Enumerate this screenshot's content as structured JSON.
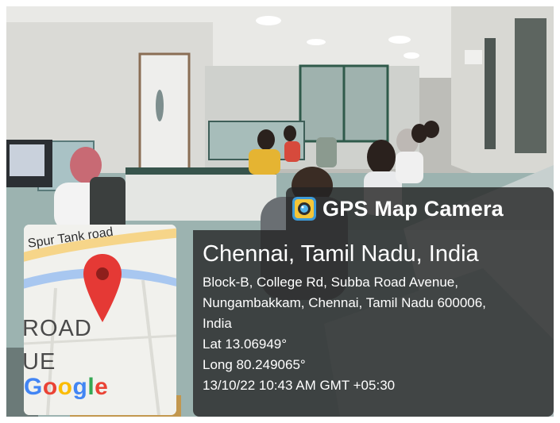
{
  "stamp": {
    "app_title": "GPS Map Camera",
    "city": "Chennai, Tamil Nadu, India",
    "address_lines": [
      "Block-B, College Rd, Subba Road Avenue,",
      "Nungambakkam, Chennai, Tamil Nadu 600006,",
      "India"
    ],
    "latitude": "Lat 13.06949°",
    "longitude": "Long 80.249065°",
    "datetime": "13/10/22 10:43 AM GMT +05:30"
  },
  "map": {
    "road_label": "Spur Tank road",
    "area_label_line1": "ROAD",
    "area_label_line2": "UE",
    "logo_text": "Google",
    "pin_color": "#e53935",
    "road_color": "#a8c7f0",
    "highlight_road_color": "#f6d589"
  },
  "icons": {
    "app": "camera-app-icon",
    "pin": "map-pin-icon"
  }
}
